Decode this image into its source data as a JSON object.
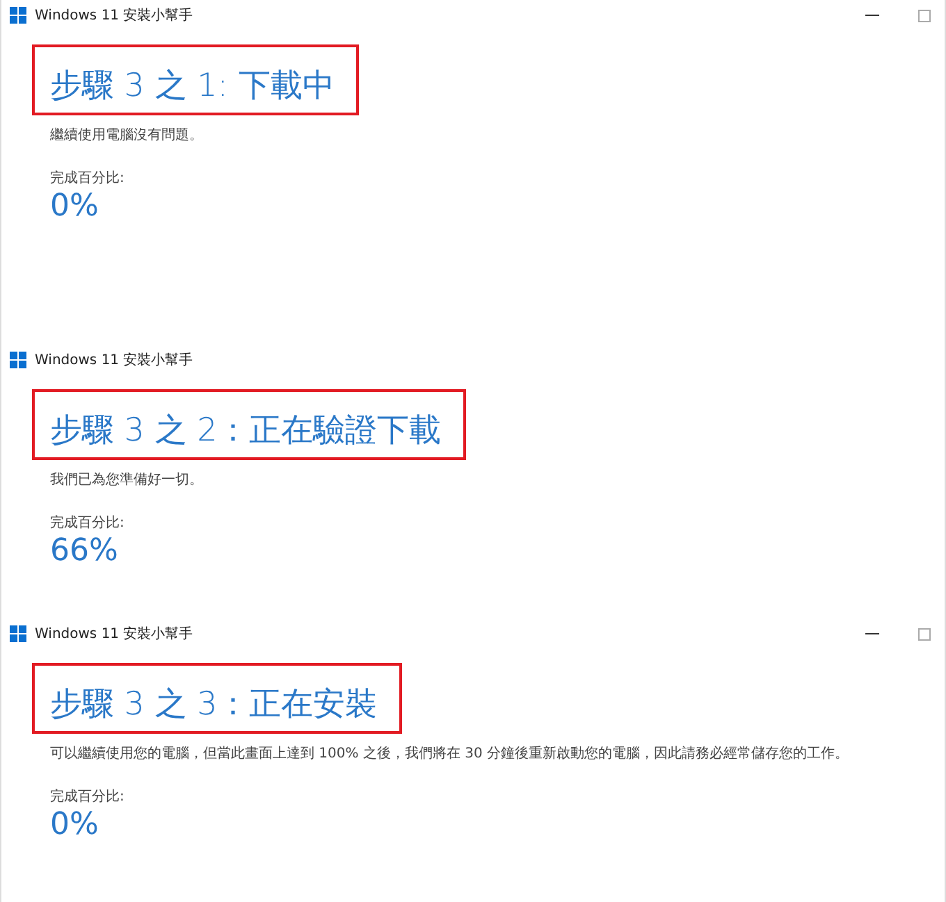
{
  "windows": [
    {
      "title": "Windows 11 安裝小幫手",
      "has_controls": true,
      "heading": "步驟 3 之 1: 下載中",
      "message": "繼續使用電腦沒有問題。",
      "progress_label": "完成百分比:",
      "progress_value": "0%"
    },
    {
      "title": "Windows 11 安裝小幫手",
      "has_controls": false,
      "heading": "步驟 3 之 2：正在驗證下載",
      "message": "我們已為您準備好一切。",
      "progress_label": "完成百分比:",
      "progress_value": "66%"
    },
    {
      "title": "Windows 11 安裝小幫手",
      "has_controls": true,
      "heading": "步驟 3 之 3：正在安裝",
      "message": "可以繼續使用您的電腦，但當此畫面上達到 100% 之後，我們將在 30 分鐘後重新啟動您的電腦，因此請務必經常儲存您的工作。",
      "progress_label": "完成百分比:",
      "progress_value": "0%"
    }
  ]
}
